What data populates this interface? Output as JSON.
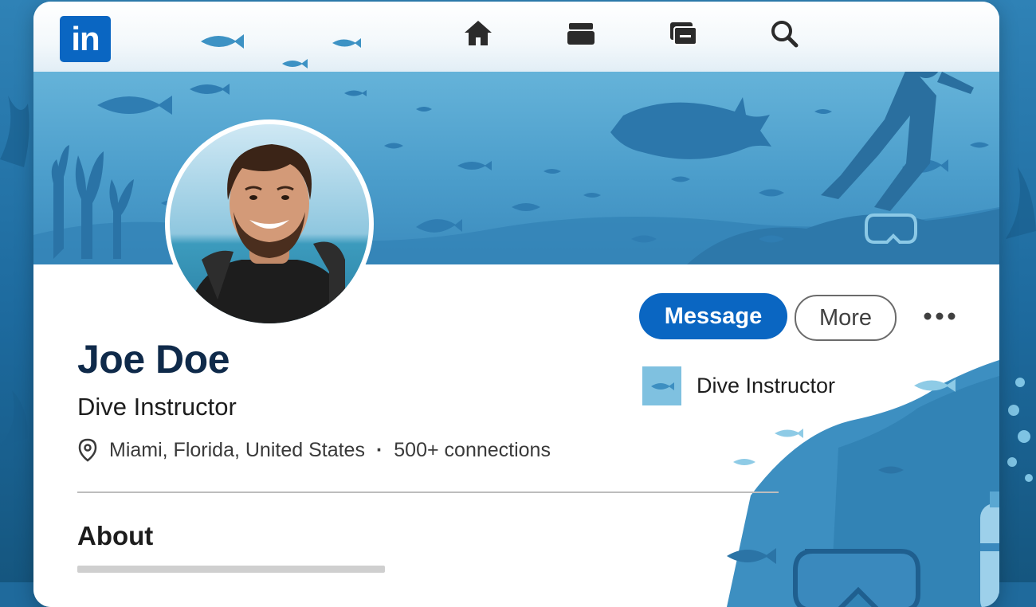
{
  "app": {
    "logo_text": "in"
  },
  "nav": {
    "items": [
      {
        "icon": "home-icon"
      },
      {
        "icon": "briefcase-icon"
      },
      {
        "icon": "messaging-icon"
      },
      {
        "icon": "search-icon"
      }
    ]
  },
  "profile": {
    "name": "Joe Doe",
    "headline": "Dive Instructor",
    "location": "Miami, Florida, United States",
    "separator": "·",
    "connections": "500+ connections",
    "current_position": "Dive Instructor"
  },
  "actions": {
    "message_label": "Message",
    "more_label": "More"
  },
  "sections": {
    "about_title": "About"
  },
  "colors": {
    "brand": "#0a66c2",
    "ocean_light": "#65b3d9",
    "ocean_dark": "#1d6a9e",
    "heading": "#0f2a4a"
  }
}
